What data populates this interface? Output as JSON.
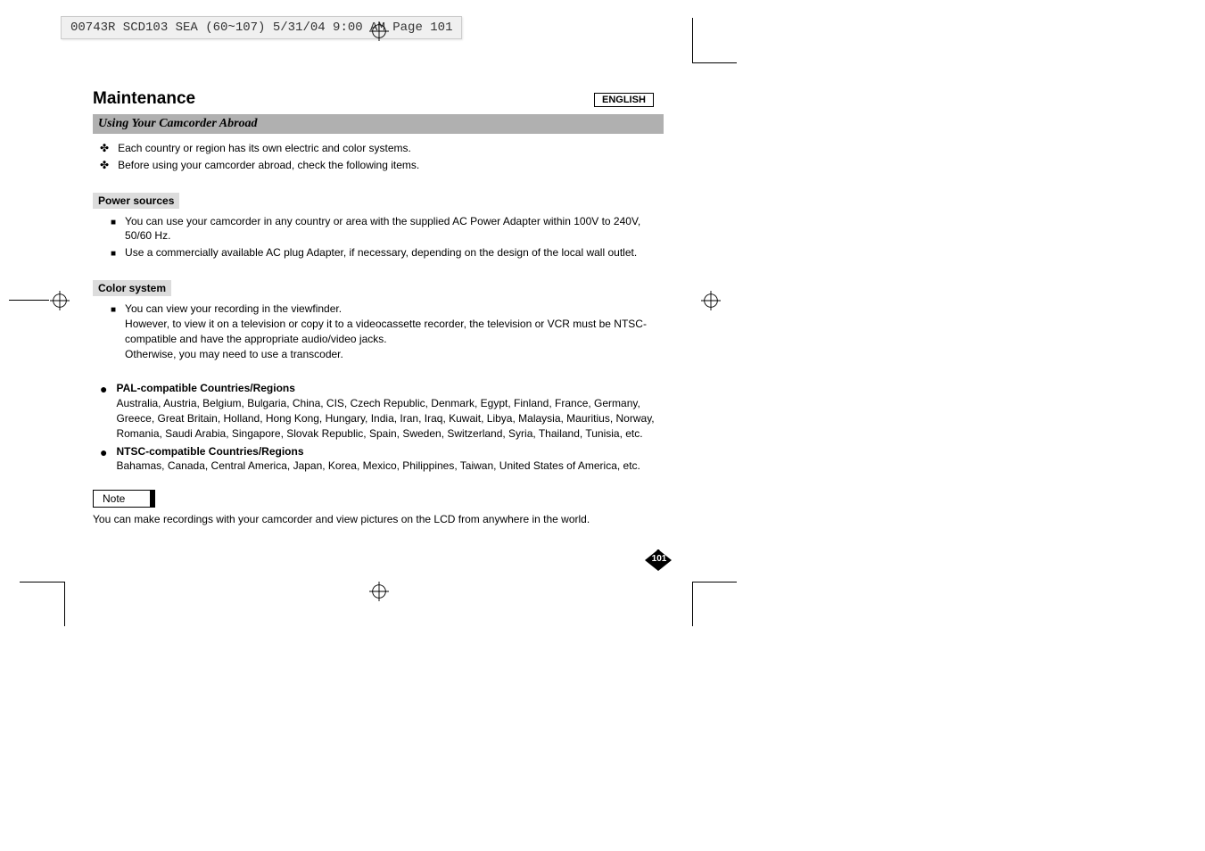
{
  "slug": "00743R SCD103 SEA (60~107)  5/31/04 9:00 AM  Page 101",
  "language_box": "ENGLISH",
  "main_heading": "Maintenance",
  "sub_heading": "Using Your Camcorder Abroad",
  "intro_bullets": [
    "Each country or region has its own electric and color systems.",
    "Before using your camcorder abroad, check the following items."
  ],
  "sections": {
    "power": {
      "label": "Power sources",
      "items": [
        "You can use your camcorder in any country or area with the supplied AC Power Adapter within 100V to 240V, 50/60 Hz.",
        "Use a commercially available AC plug Adapter, if necessary, depending on the design of the local wall outlet."
      ]
    },
    "color": {
      "label": "Color system",
      "items": [
        "You can view your recording in the viewfinder.\nHowever, to view it on a television or copy it to a videocassette recorder, the television or VCR must be NTSC-compatible and have the appropriate audio/video jacks.\nOtherwise, you may need to use a transcoder."
      ]
    }
  },
  "regions": [
    {
      "title": "PAL-compatible Countries/Regions",
      "body": "Australia, Austria, Belgium, Bulgaria, China, CIS, Czech Republic, Denmark, Egypt, Finland, France, Germany, Greece, Great Britain, Holland, Hong Kong, Hungary, India, Iran, Iraq, Kuwait, Libya, Malaysia, Mauritius, Norway, Romania, Saudi Arabia, Singapore, Slovak Republic, Spain, Sweden, Switzerland, Syria, Thailand, Tunisia, etc."
    },
    {
      "title": "NTSC-compatible Countries/Regions",
      "body": "Bahamas, Canada, Central America, Japan, Korea, Mexico, Philippines, Taiwan, United States of America, etc."
    }
  ],
  "note": {
    "label": "Note",
    "text": "You can make recordings with your camcorder and view pictures on the LCD from anywhere in the world."
  },
  "page_number": "101"
}
